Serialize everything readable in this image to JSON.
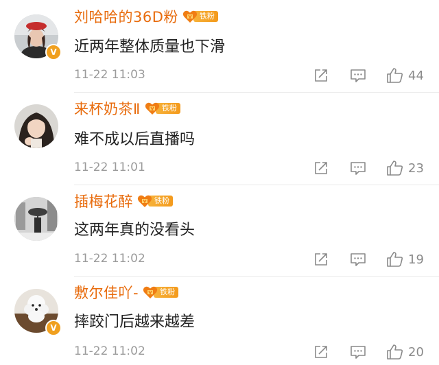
{
  "comments": [
    {
      "username": "刘哈哈的36D粉",
      "badge_label": "铁粉",
      "verified": "V",
      "text": "近两年整体质量也下滑",
      "timestamp": "11-22 11:03",
      "likes": "44",
      "avatar": "avatar-woman-red-beret"
    },
    {
      "username": "来杯奶茶Ⅱ",
      "badge_label": "铁粉",
      "text": "难不成以后直播吗",
      "timestamp": "11-22 11:01",
      "likes": "23",
      "avatar": "avatar-girl-portrait"
    },
    {
      "username": "插梅花醉",
      "badge_label": "铁粉",
      "text": "这两年真的没看头",
      "timestamp": "11-22 11:02",
      "likes": "19",
      "avatar": "avatar-snow-umbrella-scene"
    },
    {
      "username": "敷尔佳吖-",
      "badge_label": "铁粉",
      "verified": "V",
      "text": "摔跤门后越来越差",
      "timestamp": "11-22 11:02",
      "likes": "20",
      "avatar": "avatar-white-poodle"
    }
  ],
  "icons": {
    "share": "share-icon",
    "reply": "comment-icon",
    "like": "thumbs-up-icon",
    "fan_badge": "fan-heart-icon"
  },
  "colors": {
    "username": "#e86b0c",
    "badge": "#f49a1c",
    "verified": "#f0a020",
    "text": "#222222",
    "meta": "#9b9b9b"
  }
}
